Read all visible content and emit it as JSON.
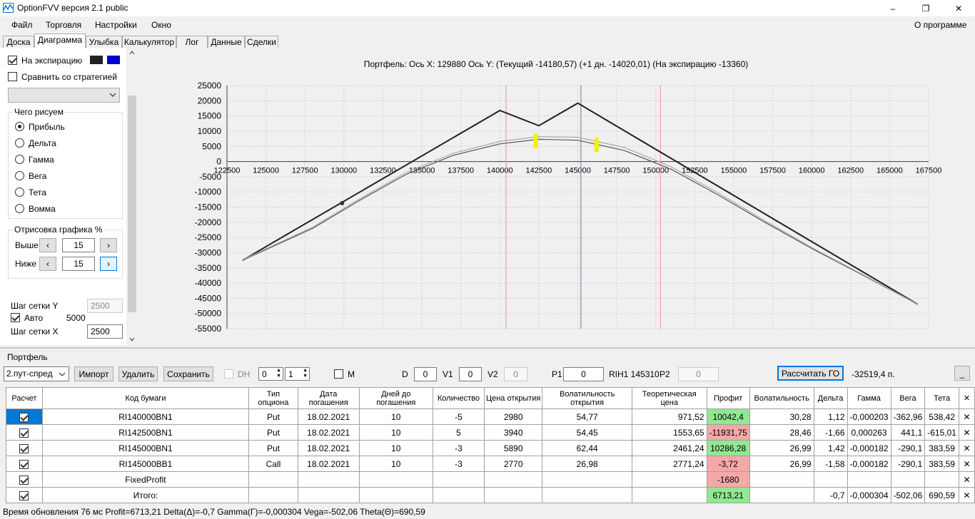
{
  "window": {
    "title": "OptionFVV версия 2.1 public",
    "minimize": "–",
    "maximize": "❐",
    "close": "✕"
  },
  "menu": {
    "items": [
      "Файл",
      "Торговля",
      "Настройки",
      "Окно"
    ],
    "about": "О программе"
  },
  "tabs": [
    "Доска",
    "Диаграмма",
    "Улыбка",
    "Калькулятор",
    "Лог",
    "Данные",
    "Сделки"
  ],
  "left": {
    "to_expiration": "На экспирацию",
    "compare": "Сравнить со стратегией",
    "draw_group": "Чего рисуем",
    "draw_options": [
      "Прибыль",
      "Дельта",
      "Гамма",
      "Вега",
      "Тета",
      "Вомма"
    ],
    "render_group": "Отрисовка графика %",
    "above_label": "Выше",
    "above_value": "15",
    "below_label": "Ниже",
    "below_value": "15",
    "grid_y_label": "Шаг сетки Y",
    "grid_y_value": "2500",
    "auto_label": "Авто",
    "auto_value": "5000",
    "grid_x_label": "Шаг сетки X",
    "grid_x_value": "2500",
    "swatch_colors": [
      "#222222",
      "#0000cc"
    ]
  },
  "chart_data": {
    "type": "line",
    "title": "Портфель:  Ось X:  129880  Ось Y:   (Текущий  -14180,57)   (+1 дн.  -14020,01)   (На экспирацию  -13360)",
    "xlim": [
      122500,
      167500
    ],
    "ylim": [
      -55000,
      25000
    ],
    "x_ticks": [
      "122500",
      "125000",
      "127500",
      "130000",
      "132500",
      "135000",
      "137500",
      "140000",
      "142500",
      "145000",
      "147500",
      "150000",
      "152500",
      "155000",
      "157500",
      "160000",
      "162500",
      "165000",
      "167500"
    ],
    "y_ticks": [
      "25000",
      "20000",
      "15000",
      "10000",
      "5000",
      "0",
      "-5000",
      "-10000",
      "-15000",
      "-20000",
      "-25000",
      "-30000",
      "-35000",
      "-40000",
      "-45000",
      "-50000",
      "-55000"
    ],
    "series": [
      {
        "color": "#222222",
        "points": [
          [
            123500,
            -32500
          ],
          [
            140000,
            16800
          ],
          [
            142500,
            11800
          ],
          [
            145000,
            19200
          ],
          [
            166800,
            -47000
          ]
        ]
      },
      {
        "color": "#555555",
        "points": [
          [
            123500,
            -32500
          ],
          [
            128000,
            -22000
          ],
          [
            131000,
            -12800
          ],
          [
            134000,
            -4200
          ],
          [
            137000,
            2000
          ],
          [
            140000,
            5800
          ],
          [
            142500,
            7300
          ],
          [
            145000,
            7000
          ],
          [
            148000,
            3600
          ],
          [
            151000,
            -2600
          ],
          [
            154000,
            -11000
          ],
          [
            157000,
            -20000
          ],
          [
            160000,
            -28600
          ],
          [
            163500,
            -38000
          ],
          [
            166800,
            -47000
          ]
        ]
      },
      {
        "color": "#aaaaaa",
        "points": [
          [
            123500,
            -32300
          ],
          [
            128000,
            -21600
          ],
          [
            131000,
            -12300
          ],
          [
            134000,
            -3600
          ],
          [
            137000,
            2700
          ],
          [
            140000,
            6600
          ],
          [
            142500,
            8200
          ],
          [
            145000,
            8000
          ],
          [
            148000,
            4600
          ],
          [
            151000,
            -1800
          ],
          [
            154000,
            -10300
          ],
          [
            157000,
            -19500
          ],
          [
            160000,
            -28300
          ],
          [
            163500,
            -37800
          ],
          [
            166800,
            -47000
          ]
        ]
      }
    ],
    "vlines": [
      {
        "x": 140400,
        "color": "#f0a0a8"
      },
      {
        "x": 145200,
        "color": "#7090b0"
      },
      {
        "x": 150300,
        "color": "#f0a0a8"
      }
    ],
    "markers": [
      {
        "x": 142300,
        "y": 6800,
        "color": "#f2f200"
      },
      {
        "x": 146200,
        "y": 5400,
        "color": "#f2f200"
      },
      {
        "x": 129880,
        "y": -13700,
        "color": "#333333"
      }
    ]
  },
  "bottom": {
    "portfolio_label": "Портфель",
    "strategy_select": "2.пут-спред",
    "import": "Импорт",
    "delete": "Удалить",
    "save": "Сохранить",
    "dh": "DH",
    "spin1": "0",
    "spin2": "1",
    "m": "M",
    "d_label": "D",
    "d_value": "0",
    "v1_label": "V1",
    "v1_value": "0",
    "v2_label": "V2",
    "v2_value": "0",
    "p1_label": "P1",
    "p1_value": "0",
    "rih": "RIH1 145310",
    "p2_label": "P2",
    "p2_value": "0",
    "calc_go": "Рассчитать ГО",
    "go_value": "-32519,4 п.",
    "minimize": "_"
  },
  "table": {
    "headers": [
      "Расчет",
      "Код бумаги",
      "Тип опциона",
      "Дата погашения",
      "Дней до погашения",
      "Количество",
      "Цена открытия",
      "Волатильность открытия",
      "Теоретическая цена",
      "Профит",
      "Волатильность",
      "Дельта",
      "Гамма",
      "Вега",
      "Тета",
      "✕"
    ],
    "rows": [
      [
        "RI140000BN1",
        "Put",
        "18.02.2021",
        "10",
        "-5",
        "2980",
        "54,77",
        "971,52",
        "10042,4",
        "30,28",
        "1,12",
        "-0,000203",
        "-362,96",
        "538,42"
      ],
      [
        "RI142500BN1",
        "Put",
        "18.02.2021",
        "10",
        "5",
        "3940",
        "54,45",
        "1553,65",
        "-11931,75",
        "28,46",
        "-1,66",
        "0,000263",
        "441,1",
        "-615,01"
      ],
      [
        "RI145000BN1",
        "Put",
        "18.02.2021",
        "10",
        "-3",
        "5890",
        "62,44",
        "2461,24",
        "10286,28",
        "26,99",
        "1,42",
        "-0,000182",
        "-290,1",
        "383,59"
      ],
      [
        "RI145000BB1",
        "Call",
        "18.02.2021",
        "10",
        "-3",
        "2770",
        "26,98",
        "2771,24",
        "-3,72",
        "26,99",
        "-1,58",
        "-0,000182",
        "-290,1",
        "383,59"
      ],
      [
        "FixedProfit",
        "",
        "",
        "",
        "",
        "",
        "",
        "",
        "-1680",
        "",
        "",
        "",
        "",
        ""
      ],
      [
        "Итого:",
        "",
        "",
        "",
        "",
        "",
        "",
        "",
        "6713,21",
        "",
        "-0,7",
        "-0,000304",
        "-502,06",
        "690,59"
      ]
    ],
    "profit_sign": [
      "pos",
      "neg",
      "pos",
      "neg",
      "neg",
      "pos"
    ]
  },
  "status": "Время обновления 76 мс  Profit=6713,21 Delta(Δ)=-0,7 Gamma(Γ)=-0,000304 Vega=-502,06 Theta(Θ)=690,59"
}
